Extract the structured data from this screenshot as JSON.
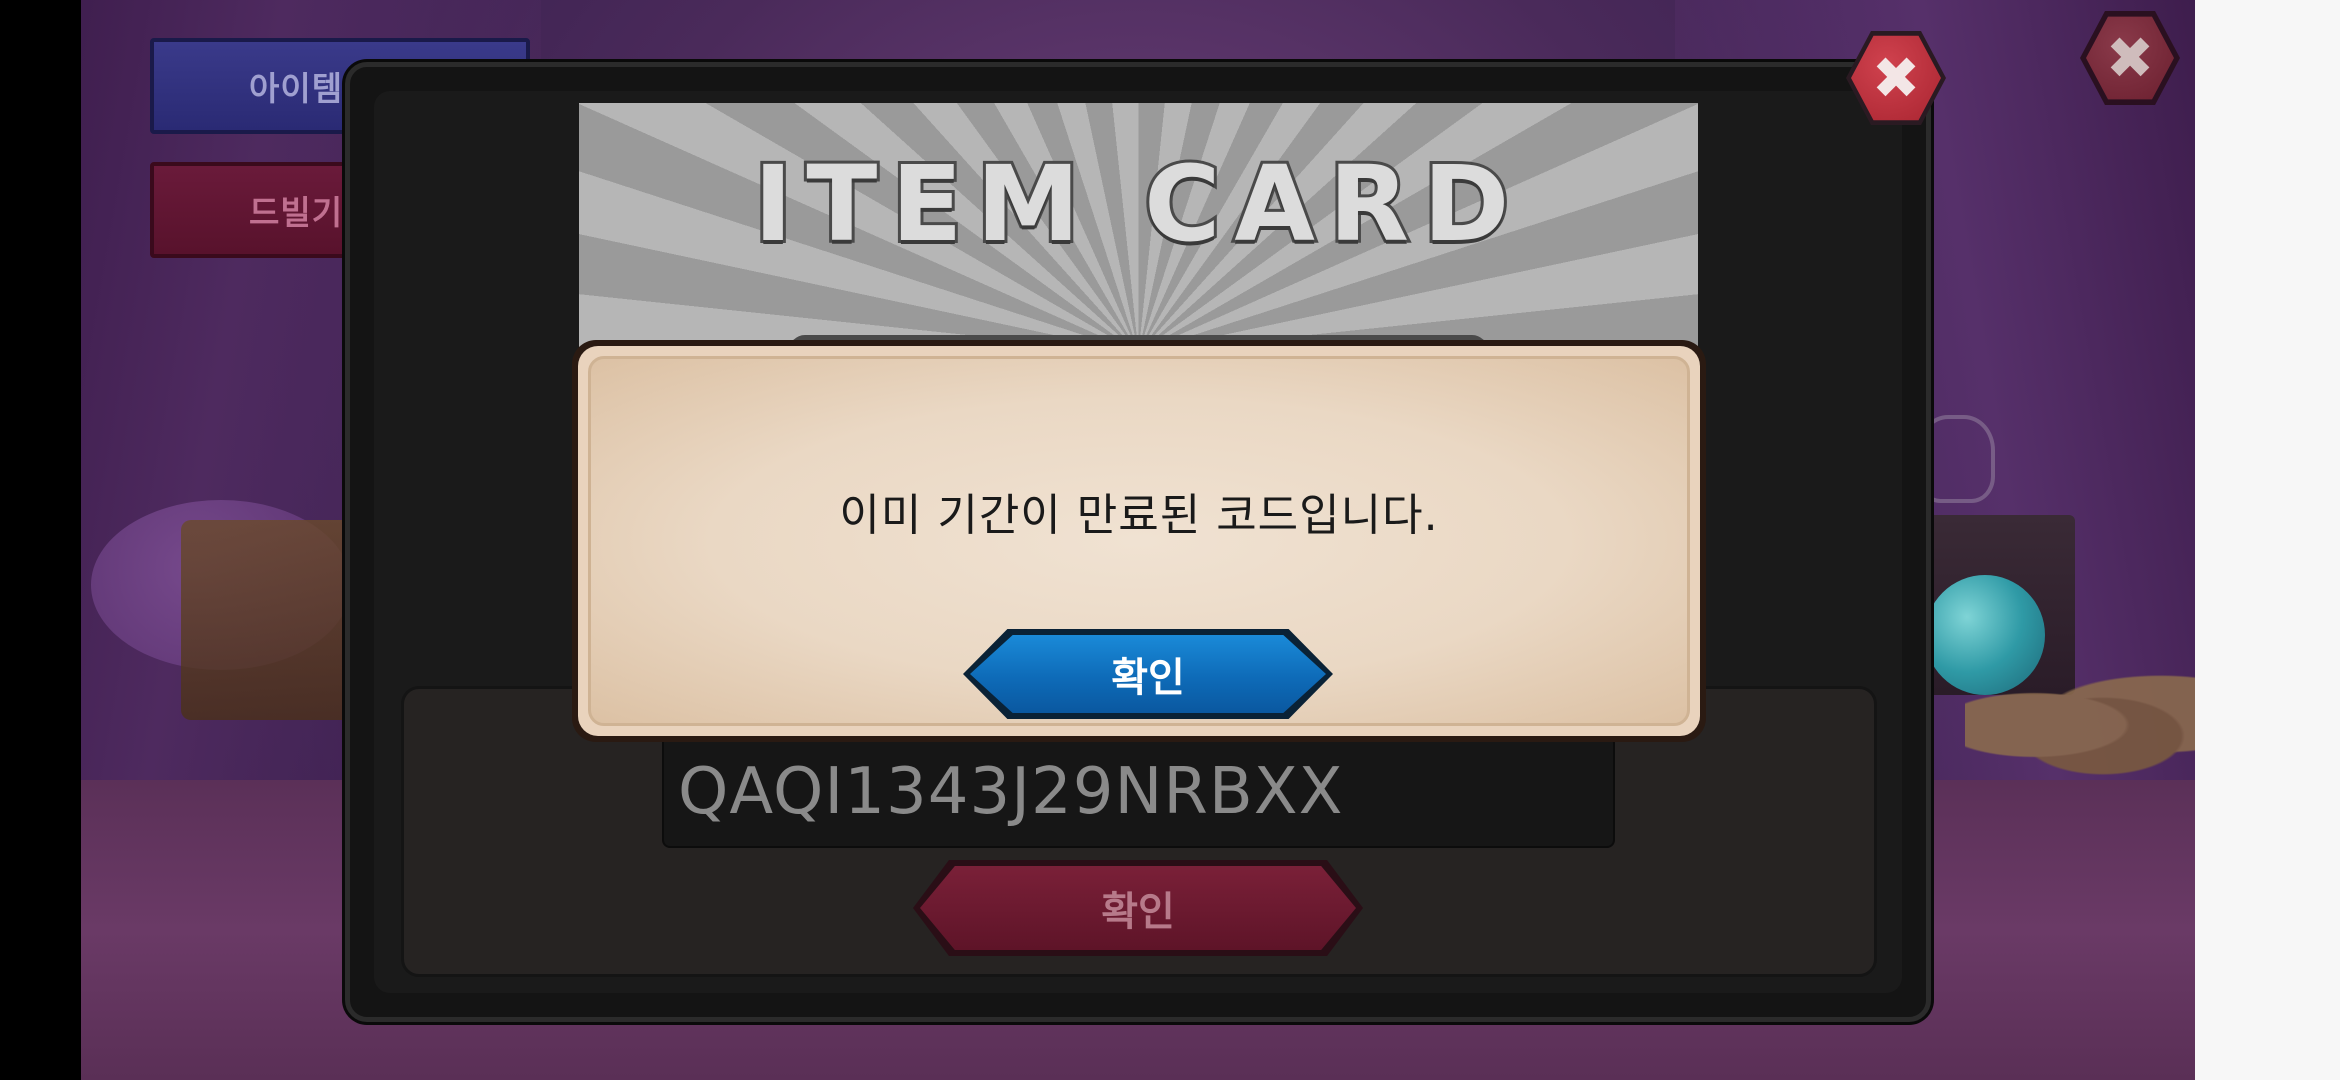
{
  "side_menu": {
    "item_code_label": "아이템코",
    "dvil_label": "드빌기"
  },
  "outer_close": {
    "icon": "close-icon",
    "glyph": "✖"
  },
  "code_dialog": {
    "close_icon": "close-icon",
    "close_glyph": "✖",
    "banner_title": "ITEM CARD",
    "code_value": "QAQI1343J29NRBXX",
    "submit_label": "확인"
  },
  "alert": {
    "message": "이미 기간이 만료된 코드입니다.",
    "confirm_label": "확인"
  },
  "colors": {
    "alert_confirm": "#0e6bb8",
    "submit": "#6a1a30",
    "close": "#c22e3a"
  }
}
